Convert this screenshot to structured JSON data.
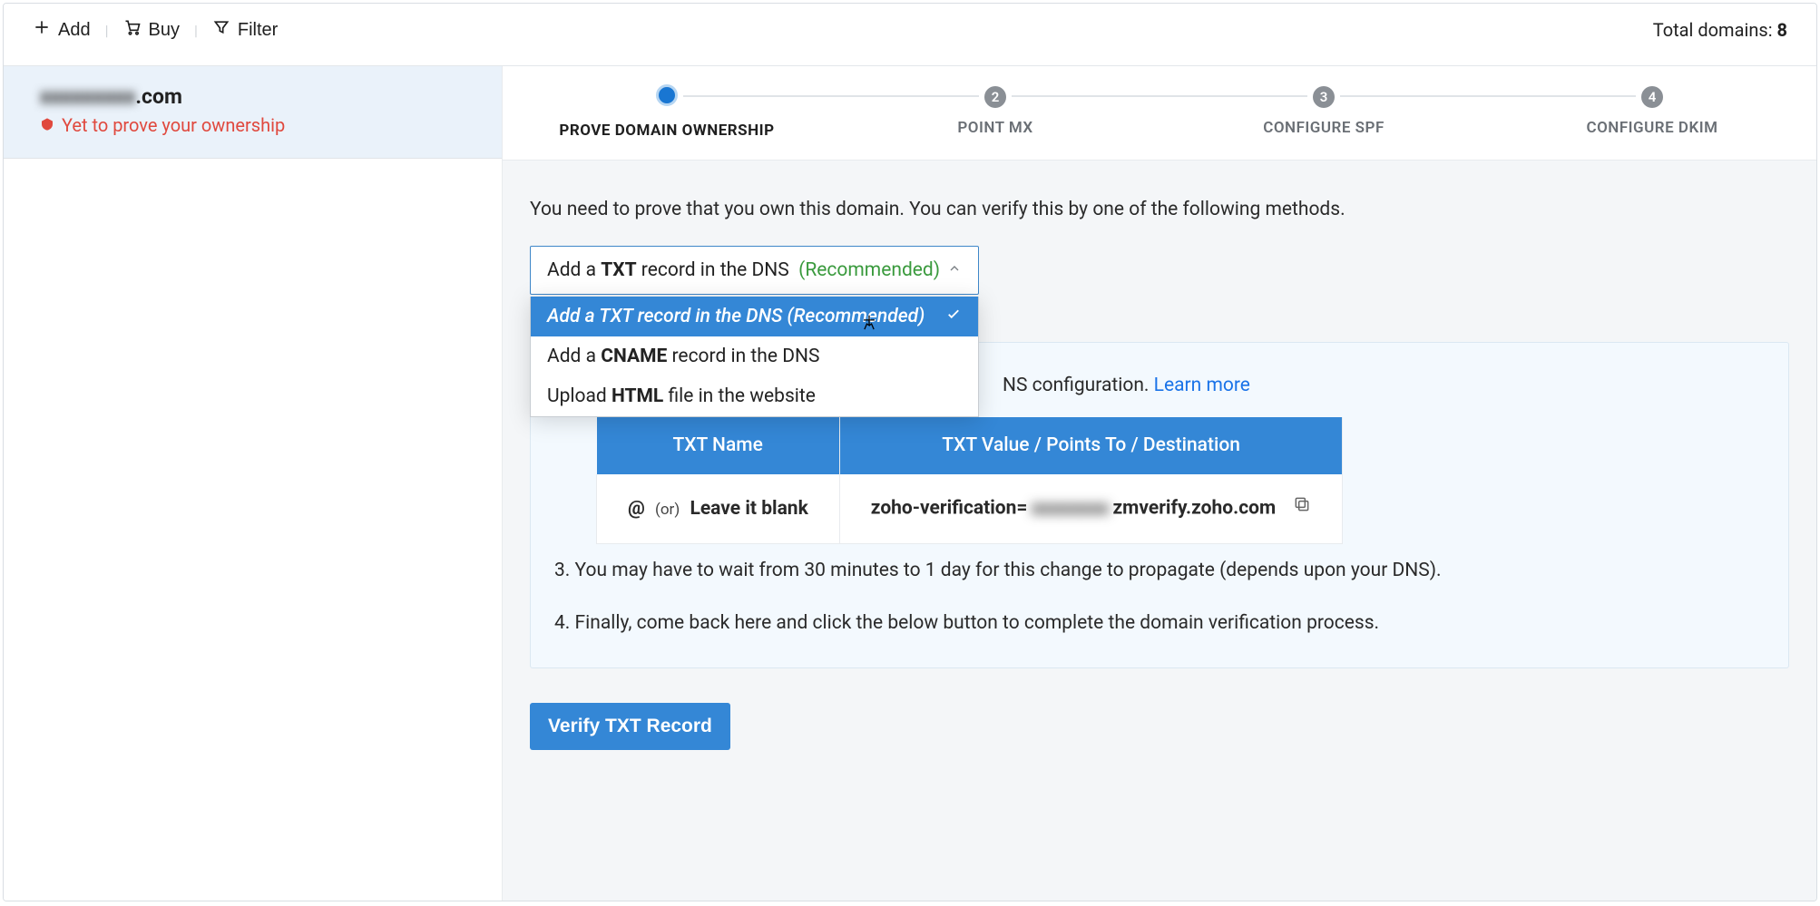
{
  "toolbar": {
    "add_label": "Add",
    "buy_label": "Buy",
    "filter_label": "Filter",
    "total_label": "Total domains: ",
    "total_count": "8"
  },
  "sidebar": {
    "domain_blur": "xxxxxxxxx",
    "domain_suffix": ".com",
    "status_label": "Yet to prove your ownership"
  },
  "stepper": {
    "steps": [
      {
        "num": "",
        "label": "PROVE DOMAIN OWNERSHIP"
      },
      {
        "num": "2",
        "label": "POINT MX"
      },
      {
        "num": "3",
        "label": "CONFIGURE SPF"
      },
      {
        "num": "4",
        "label": "CONFIGURE DKIM"
      }
    ]
  },
  "intro_text": "You need to prove that you own this domain. You can verify this by one of the following methods.",
  "dropdown": {
    "selected_prefix": "Add a ",
    "selected_bold": "TXT",
    "selected_suffix": " record in the DNS",
    "selected_rec": "(Recommended)",
    "options": [
      "Add a TXT record in the DNS (Recommended)",
      "Add a CNAME record in the DNS",
      "Upload HTML file in the website"
    ]
  },
  "panel": {
    "line2_visible": "NS configuration. ",
    "learn_more": "Learn more",
    "table": {
      "th_name": "TXT Name",
      "th_value": "TXT Value / Points To / Destination",
      "name_at": "@",
      "name_or": "(or)",
      "name_leave": "Leave it blank",
      "value_prefix": "zoho-verification=",
      "value_blur": "xxxxxxxx",
      "value_suffix": "zmverify.zoho.com"
    },
    "line3": "3. You may have to wait from 30 minutes to 1 day for this change to propagate (depends upon your DNS).",
    "line4": "4. Finally, come back here and click the below button to complete the domain verification process."
  },
  "verify_button": "Verify TXT Record"
}
